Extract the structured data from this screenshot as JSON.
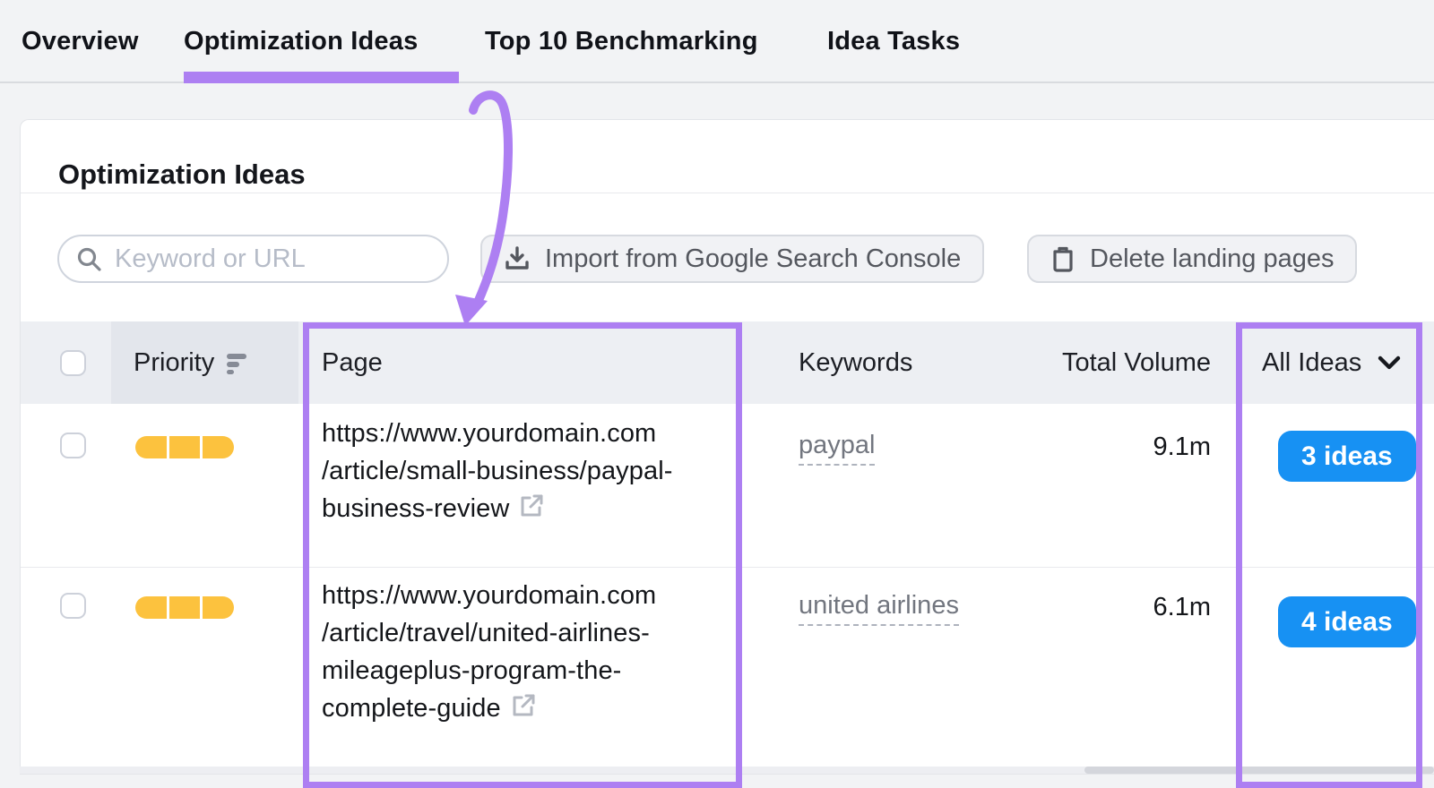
{
  "tabs": [
    {
      "label": "Overview",
      "active": false
    },
    {
      "label": "Optimization Ideas",
      "active": true
    },
    {
      "label": "Top 10 Benchmarking",
      "active": false
    },
    {
      "label": "Idea Tasks",
      "active": false
    }
  ],
  "panel": {
    "title": "Optimization Ideas"
  },
  "toolbar": {
    "search_placeholder": "Keyword or URL",
    "import_label": "Import from Google Search Console",
    "delete_label": "Delete landing pages"
  },
  "table": {
    "headers": {
      "priority": "Priority",
      "page": "Page",
      "keywords": "Keywords",
      "total_volume": "Total Volume",
      "ideas_filter": "All Ideas"
    },
    "rows": [
      {
        "priority_level": "high",
        "page_lines": [
          "https://www.yourdomain.com",
          "/article/small-business/paypal-",
          "business-review"
        ],
        "keyword": "paypal",
        "total_volume": "9.1m",
        "ideas_label": "3 ideas"
      },
      {
        "priority_level": "high",
        "page_lines": [
          "https://www.yourdomain.com",
          "/article/travel/united-airlines-",
          "mileageplus-program-the-",
          "complete-guide"
        ],
        "keyword": "united airlines",
        "total_volume": "6.1m",
        "ideas_label": "4 ideas"
      }
    ]
  },
  "colors": {
    "annotation_purple": "#ad7ff2",
    "ideas_blue": "#1791f3",
    "priority_amber": "#fcc23e"
  }
}
